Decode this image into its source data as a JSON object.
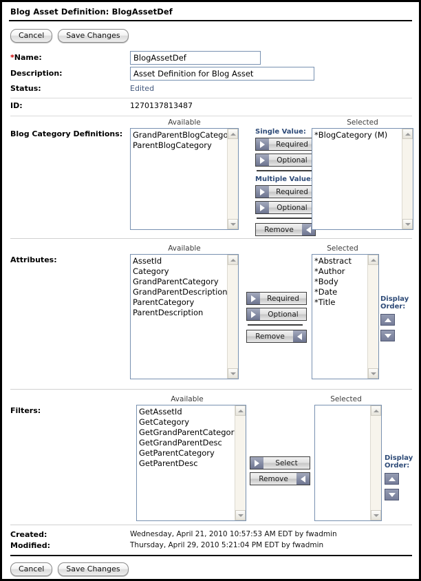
{
  "header": {
    "title": "Blog Asset Definition: BlogAssetDef"
  },
  "toolbar": {
    "cancel_label": "Cancel",
    "save_label": "Save Changes"
  },
  "footer_toolbar": {
    "cancel_label": "Cancel",
    "save_label": "Save Changes"
  },
  "fields": {
    "name": {
      "required_marker": "*",
      "label": "Name:",
      "value": "BlogAssetDef"
    },
    "description": {
      "label": "Description:",
      "value": "Asset Definition for Blog Asset"
    },
    "status": {
      "label": "Status:",
      "value": "Edited"
    },
    "id": {
      "label": "ID:",
      "value": "1270137813487"
    }
  },
  "column_headers": {
    "available": "Available",
    "selected": "Selected"
  },
  "category_definitions": {
    "label": "Blog Category Definitions:",
    "available": [
      "GrandParentBlogCategory",
      "ParentBlogCategory"
    ],
    "selected": [
      "*BlogCategory (M)"
    ],
    "single_value_label": "Single Value:",
    "multiple_values_label": "Multiple Values:",
    "buttons": {
      "single_required": "Required",
      "single_optional": "Optional",
      "multi_required": "Required",
      "multi_optional": "Optional",
      "remove": "Remove"
    }
  },
  "attributes": {
    "label": "Attributes:",
    "available": [
      "AssetId",
      "Category",
      "GrandParentCategory",
      "GrandParentDescription",
      "ParentCategory",
      "ParentDescription"
    ],
    "selected": [
      "*Abstract",
      "*Author",
      "*Body",
      "*Date",
      "*Title"
    ],
    "buttons": {
      "required": "Required",
      "optional": "Optional",
      "remove": "Remove"
    },
    "display_order_label": "Display Order:"
  },
  "filters": {
    "label": "Filters:",
    "available": [
      "GetAssetId",
      "GetCategory",
      "GetGrandParentCategory",
      "GetGrandParentDesc",
      "GetParentCategory",
      "GetParentDesc"
    ],
    "selected": [],
    "buttons": {
      "select": "Select",
      "remove": "Remove"
    },
    "display_order_label": "Display Order:"
  },
  "audit": {
    "created_label": "Created:",
    "created_value": "Wednesday, April 21, 2010 10:57:53 AM EDT by fwadmin",
    "modified_label": "Modified:",
    "modified_value": "Thursday, April 29, 2010 5:21:04 PM EDT by fwadmin"
  },
  "colors": {
    "accent_blue": "#2d4a77",
    "field_border": "#7790b0",
    "required_star": "#cc0000",
    "status_text": "#41577d",
    "order_button": "#767d99"
  }
}
